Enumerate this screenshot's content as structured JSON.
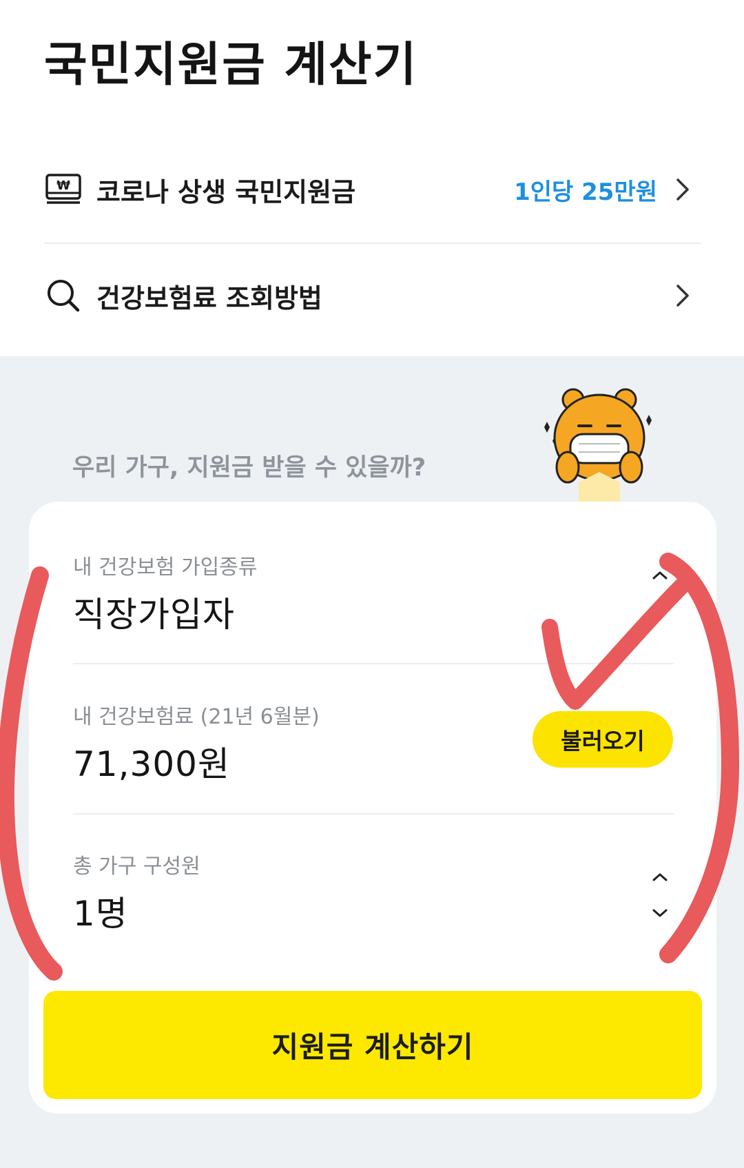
{
  "page": {
    "title": "국민지원금 계산기"
  },
  "links": [
    {
      "icon": "won-banknote-icon",
      "label": "코로나 상생 국민지원금",
      "value": "1인당 25만원"
    },
    {
      "icon": "search-icon",
      "label": "건강보험료 조회방법",
      "value": ""
    }
  ],
  "section": {
    "question": "우리 가구, 지원금 받을 수 있을까?",
    "mascot": "bear-mascot-with-mask"
  },
  "form": {
    "insurance_type": {
      "label": "내 건강보험 가입종류",
      "value": "직장가입자"
    },
    "premium": {
      "label": "내 건강보험료 (21년 6월분)",
      "value": "71,300원",
      "button": "불러오기"
    },
    "household": {
      "label": "총 가구 구성원",
      "value": "1명"
    }
  },
  "cta": {
    "label": "지원금 계산하기"
  },
  "colors": {
    "accent_yellow": "#fde800",
    "link_blue": "#1d8fe1",
    "annotation_red": "#e85a5c",
    "section_bg": "#eef1f4"
  }
}
